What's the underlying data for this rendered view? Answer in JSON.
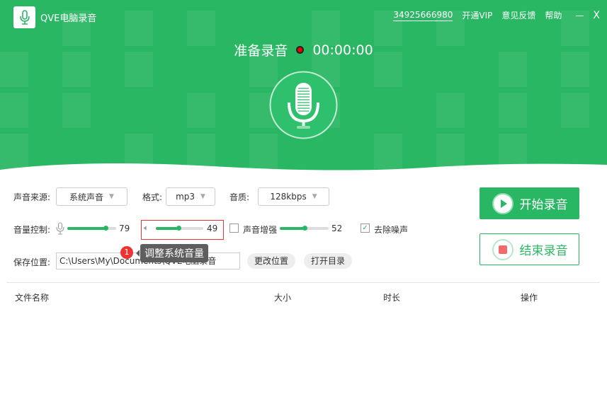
{
  "app": {
    "title": "QVE电脑录音"
  },
  "top_links": {
    "account": "34925666980",
    "vip": "开通VIP",
    "feedback": "意见反馈",
    "help": "帮助",
    "minimize": "—",
    "close": "X"
  },
  "status": {
    "label": "准备录音",
    "time": "00:00:00"
  },
  "settings": {
    "source_label": "声音来源:",
    "source_value": "系统声音",
    "format_label": "格式:",
    "format_value": "mp3",
    "quality_label": "音质:",
    "quality_value": "128kbps",
    "volume_label": "音量控制:",
    "mic_volume": 79,
    "system_volume": 49,
    "enhance_label": "声音增强",
    "enhance_value": 52,
    "enhance_checked": false,
    "denoise_label": "去除噪声",
    "denoise_checked": true,
    "save_label": "保存位置:",
    "save_path": "C:\\Users\\My\\Documents\\QVE电脑录音",
    "change_location": "更改位置",
    "open_folder": "打开目录"
  },
  "tooltip": {
    "badge": "1",
    "text": "调整系统音量"
  },
  "buttons": {
    "start": "开始录音",
    "stop": "结束录音"
  },
  "table": {
    "columns": [
      "文件名称",
      "大小",
      "时长",
      "操作"
    ]
  },
  "colors": {
    "brand": "#2ab764",
    "record_dot": "#ee0000"
  }
}
